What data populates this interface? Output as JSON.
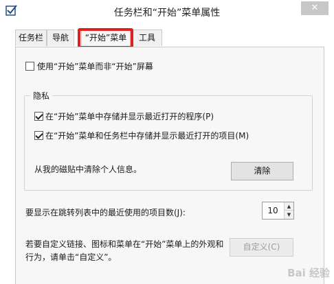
{
  "window": {
    "title": "任务栏和“开始”菜单属性",
    "close_label": "✕"
  },
  "tabs": [
    {
      "label": "任务栏"
    },
    {
      "label": "导航"
    },
    {
      "label": "“开始”菜单"
    },
    {
      "label": "工具栏"
    }
  ],
  "active_tab": "“开始”菜单",
  "start_screen_option": {
    "label": "使用“开始”菜单而非“开始”屏幕",
    "checked": false
  },
  "privacy": {
    "title": "隐私",
    "store_programs": {
      "label": "在“开始”菜单中存储并显示最近打开的程序(P)",
      "checked": true
    },
    "store_items": {
      "label": "在“开始”菜单和任务栏中存储并显示最近打开的项目(M)",
      "checked": true
    },
    "clear_text": "从我的磁贴中清除个人信息。",
    "clear_button": "清除"
  },
  "jump_list": {
    "label": "要显示在跳转列表中的最近使用的项目数(J):",
    "value": "10"
  },
  "customize": {
    "text_line1": "若要自定义链接、图标和菜单在“开始”菜单上的外观和",
    "text_line2": "行为，请单击“自定义”。",
    "button": "自定义(C)"
  },
  "watermark": "Bai 经验"
}
